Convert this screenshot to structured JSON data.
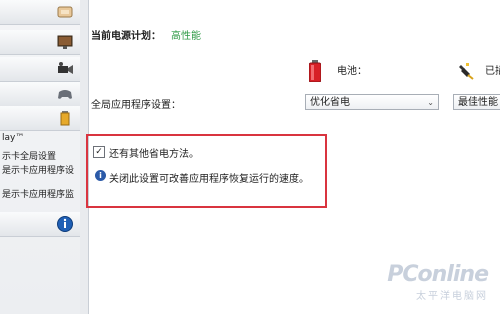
{
  "window": {
    "top_truncated_text": "Play"
  },
  "sidebar": {
    "items": [
      {
        "icon": "display-icon"
      },
      {
        "icon": "monitor-icon"
      },
      {
        "icon": "video-camera-icon"
      },
      {
        "icon": "gamepad-icon"
      },
      {
        "icon": "battery-icon"
      }
    ],
    "texts": [
      "lay™",
      "示卡全局设置",
      "是示卡应用程序设",
      "是示卡应用程序监"
    ],
    "bottom_icon": "info-icon"
  },
  "main": {
    "plan_label": "当前电源计划：",
    "plan_value": "高性能",
    "battery_label": "电池：",
    "plugged_label": "已插",
    "global_label": "全局应用程序设置：",
    "battery_select": "优化省电",
    "plugged_select": "最佳性能",
    "checkbox_label": "还有其他省电方法。",
    "checkbox_checked": true,
    "info_text": "关闭此设置可改善应用程序恢复运行的速度。"
  },
  "watermark": {
    "logo": "PConline",
    "sub": "太平洋电脑网"
  },
  "colors": {
    "highlight": "#d9343f",
    "plan_value": "#2f9a46",
    "info": "#2b5aa8"
  }
}
